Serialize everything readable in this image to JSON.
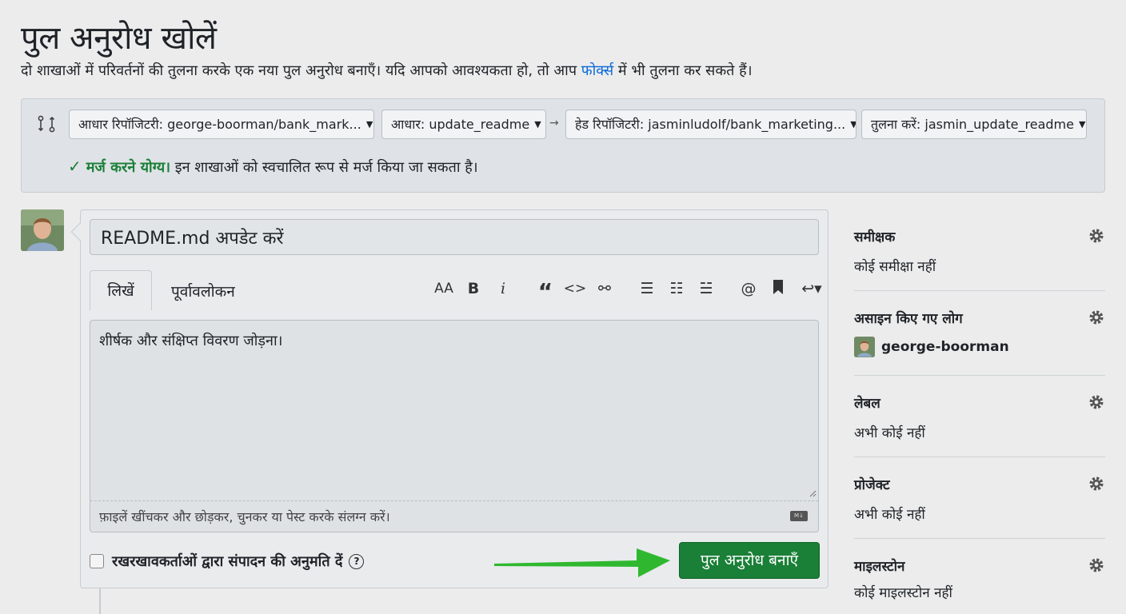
{
  "header": {
    "title": "पुल अनुरोध खोलें",
    "subtitle_before": "दो शाखाओं में परिवर्तनों की तुलना करके एक नया पुल अनुरोध बनाएँ। यदि आपको आवश्यकता हो, तो आप ",
    "subtitle_link": "फोर्क्स",
    "subtitle_after": " में भी तुलना कर सकते हैं।"
  },
  "compare": {
    "base_repo": "आधार रिपॉजिटरी: george-boorman/bank_mark...",
    "base_branch": "आधार: update_readme",
    "head_repo": "हेड रिपॉजिटरी: jasminludolf/bank_marketing...",
    "compare_branch": "तुलना करें: jasmin_update_readme",
    "merge_ok": "मर्ज करने योग्य।",
    "merge_detail": " इन शाखाओं को स्वचालित रूप से मर्ज किया जा सकता है।"
  },
  "editor": {
    "title_value": "README.md अपडेट करें",
    "tab_write": "लिखें",
    "tab_preview": "पूर्वावलोकन",
    "body_text": "शीर्षक और संक्षिप्त विवरण जोड़ना।",
    "attach_hint": "फ़ाइलें खींचकर और छोड़कर, चुनकर या पेस्ट करके संलग्न करें।",
    "toolbar": {
      "heading": "AA",
      "bold": "B",
      "italic": "i",
      "quote": "“",
      "code": "<>",
      "link": "⚯",
      "bullets": "☰",
      "numbered": "☷",
      "tasks": "☱",
      "mention": "@",
      "reply": "↩▾"
    }
  },
  "footer": {
    "allow_edits": "रखरखावकर्ताओं द्वारा संपादन की अनुमति दें",
    "help": "?",
    "submit": "पुल अनुरोध बनाएँ"
  },
  "sidebar": {
    "reviewers": {
      "title": "समीक्षक",
      "value": "कोई समीक्षा नहीं"
    },
    "assignees": {
      "title": "असाइन किए गए लोग",
      "user": "george-boorman"
    },
    "labels": {
      "title": "लेबल",
      "value": "अभी कोई नहीं"
    },
    "projects": {
      "title": "प्रोजेक्ट",
      "value": "अभी कोई नहीं"
    },
    "milestone": {
      "title": "माइलस्टोन",
      "value": "कोई माइलस्टोन नहीं"
    }
  },
  "colors": {
    "primary_green": "#1a7f37",
    "link_blue": "#0969da",
    "arrow_green": "#2fb82f"
  }
}
